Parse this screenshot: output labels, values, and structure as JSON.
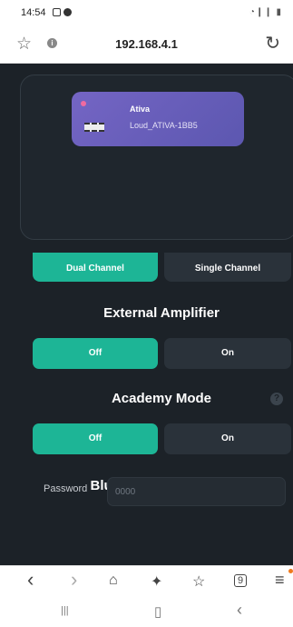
{
  "status_bar": {
    "time": "14:54",
    "right_indicators": "◔❙❙ ▮"
  },
  "browser": {
    "url": "192.168.4.1"
  },
  "device": {
    "name": "Ativa",
    "id": "Loud_ATIVA-1BB5"
  },
  "channel_mode": {
    "options": [
      "Dual Channel",
      "Single Channel"
    ],
    "selected": "Dual Channel"
  },
  "external_amplifier": {
    "title": "External Amplifier",
    "off_label": "Off",
    "on_label": "On",
    "selected": "Off"
  },
  "academy_mode": {
    "title": "Academy Mode",
    "help_glyph": "?",
    "off_label": "Off",
    "on_label": "On",
    "selected": "Off"
  },
  "bluetooth": {
    "title": "Bluetooth's Password",
    "password_label": "Password",
    "password_placeholder": "0000"
  },
  "icons": {
    "back": "‹",
    "forward": "›",
    "home": "⌂",
    "sparkle": "✦",
    "bookmarks": "☆",
    "tabs": "9",
    "menu": "≡",
    "star": "☆",
    "reload": "↻",
    "recents": "|||",
    "home_nav": "▯",
    "back_nav": "‹"
  },
  "colors": {
    "accent": "#1db596",
    "background": "#1c2228",
    "device_card": "#6a61bd"
  }
}
